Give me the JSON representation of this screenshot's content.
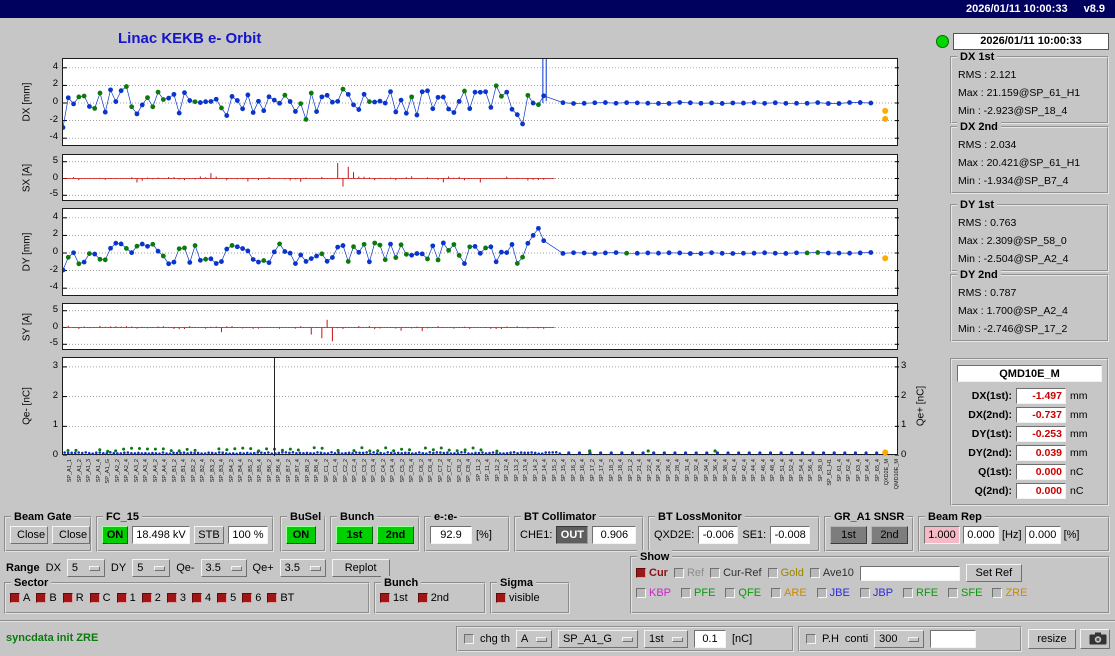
{
  "titlebar": {
    "datetime": "2026/01/11 10:00:33",
    "version": "v8.9"
  },
  "header": {
    "title": "Linac KEKB e- Orbit",
    "timestamp": "2026/01/11 10:00:33"
  },
  "stats_panels": [
    {
      "label": "DX 1st",
      "lines": [
        "RMS : 2.121",
        "Max : 21.159@SP_61_H1",
        "Min : -2.923@SP_18_4"
      ]
    },
    {
      "label": "DX 2nd",
      "lines": [
        "RMS : 2.034",
        "Max : 20.421@SP_61_H1",
        "Min : -1.934@SP_B7_4"
      ]
    },
    {
      "label": "DY 1st",
      "lines": [
        "RMS : 0.763",
        "Max : 2.309@SP_58_0",
        "Min : -2.504@SP_A2_4"
      ]
    },
    {
      "label": "DY 2nd",
      "lines": [
        "RMS : 0.787",
        "Max : 1.700@SP_A2_4",
        "Min : -2.746@SP_17_2"
      ]
    }
  ],
  "qmd": {
    "title": "QMD10E_M",
    "rows": [
      {
        "label": "DX(1st):",
        "value": "-1.497",
        "unit": "mm"
      },
      {
        "label": "DX(2nd):",
        "value": "-0.737",
        "unit": "mm"
      },
      {
        "label": "DY(1st):",
        "value": "-0.253",
        "unit": "mm"
      },
      {
        "label": "DY(2nd):",
        "value": "0.039",
        "unit": "mm"
      },
      {
        "label": "Q(1st):",
        "value": "0.000",
        "unit": "nC"
      },
      {
        "label": "Q(2nd):",
        "value": "0.000",
        "unit": "nC"
      }
    ]
  },
  "plots": {
    "dx": {
      "ylabel": "DX [mm]",
      "ticks": [
        "4",
        "2",
        "0",
        "-2",
        "-4"
      ],
      "ymin": -5,
      "ymax": 5
    },
    "sx": {
      "ylabel": "SX [A]",
      "ticks": [
        "5",
        "0",
        "-5"
      ],
      "ymin": -7,
      "ymax": 7
    },
    "dy": {
      "ylabel": "DY [mm]",
      "ticks": [
        "4",
        "2",
        "0",
        "-2",
        "-4"
      ],
      "ymin": -5,
      "ymax": 5
    },
    "sy": {
      "ylabel": "SY [A]",
      "ticks": [
        "5",
        "0",
        "-5"
      ],
      "ymin": -7,
      "ymax": 7
    },
    "q": {
      "ylabel": "Qe- [nC]",
      "ylabel_right": "Qe+ [nC]",
      "ticks": [
        "3",
        "2",
        "1",
        "0"
      ],
      "ticks_right": [
        "3",
        "2",
        "1",
        "0"
      ],
      "ymin": 0,
      "ymax": 3.3
    }
  },
  "xlabels": [
    "SP_A1_1",
    "SP_A1_2",
    "SP_A1_3",
    "SP_A1_4",
    "SP_A1_G",
    "SP_A2_2",
    "SP_A2_4",
    "SP_A3_2",
    "SP_A3_4",
    "SP_A4_2",
    "SP_A4_4",
    "SP_B1_2",
    "SP_B1_4",
    "SP_B2_2",
    "SP_B2_4",
    "SP_B3_2",
    "SP_B3_4",
    "SP_B4_2",
    "SP_B4_4",
    "SP_B5_2",
    "SP_B5_4",
    "SP_B6_2",
    "SP_B6_4",
    "SP_B7_2",
    "SP_B7_4",
    "SP_B8_2",
    "SP_B8_4",
    "SP_C1_2",
    "SP_C1_4",
    "SP_C2_2",
    "SP_C2_4",
    "SP_C3_2",
    "SP_C3_4",
    "SP_C4_2",
    "SP_C4_4",
    "SP_C5_2",
    "SP_C5_4",
    "SP_C6_2",
    "SP_C6_4",
    "SP_C7_2",
    "SP_C7_4",
    "SP_C8_2",
    "SP_C8_4",
    "SP_11_2",
    "SP_11_4",
    "SP_12_2",
    "SP_12_4",
    "SP_13_2",
    "SP_13_4",
    "SP_14_2",
    "SP_14_4",
    "SP_15_2",
    "SP_15_4",
    "SP_16_2",
    "SP_16_4",
    "SP_17_2",
    "SP_17_4",
    "SP_18_2",
    "SP_18_4",
    "SP_21_2",
    "SP_21_4",
    "SP_22_4",
    "SP_24_4",
    "SP_26_4",
    "SP_28_4",
    "SP_31_4",
    "SP_32_4",
    "SP_34_4",
    "SP_36_4",
    "SP_38_4",
    "SP_41_4",
    "SP_42_4",
    "SP_44_4",
    "SP_46_4",
    "SP_48_4",
    "SP_51_4",
    "SP_52_4",
    "SP_54_4",
    "SP_56_4",
    "SP_58_0",
    "SP_61_H1",
    "SP_61_4",
    "SP_62_4",
    "SP_63_4",
    "SP_64_4",
    "SP_65_4",
    "QXD2E_M",
    "QMD10E_M"
  ],
  "controls": {
    "beam_gate": {
      "label": "Beam Gate",
      "close1": "Close",
      "close2": "Close"
    },
    "fc15": {
      "label": "FC_15",
      "on": "ON",
      "kv": "18.498 kV",
      "stb": "STB",
      "pct": "100 %"
    },
    "busel": {
      "label": "BuSel",
      "on": "ON"
    },
    "bunch": {
      "label": "Bunch",
      "first": "1st",
      "second": "2nd"
    },
    "ee": {
      "label": "e-:e-",
      "value": "92.9",
      "unit": "[%]"
    },
    "bt_collimator": {
      "label": "BT Collimator",
      "che1": "CHE1:",
      "state": "OUT",
      "value": "0.906"
    },
    "bt_lossmonitor": {
      "label": "BT LossMonitor",
      "qxd2e_label": "QXD2E:",
      "qxd2e": "-0.006",
      "se1_label": "SE1:",
      "se1": "-0.008"
    },
    "gr_a1": {
      "label": "GR_A1 SNSR",
      "first": "1st",
      "second": "2nd"
    },
    "beam_rep": {
      "label": "Beam Rep",
      "v1": "1.000",
      "v2": "0.000",
      "hz": "[Hz]",
      "v3": "0.000",
      "pct": "[%]"
    },
    "range": {
      "label": "Range",
      "dx_label": "DX",
      "dx": "5",
      "dy_label": "DY",
      "dy": "5",
      "qem_label": "Qe-",
      "qem": "3.5",
      "qep_label": "Qe+",
      "qep": "3.5",
      "replot": "Replot"
    },
    "sector": {
      "label": "Sector",
      "items": [
        "A",
        "B",
        "R",
        "C",
        "1",
        "2",
        "3",
        "4",
        "5",
        "6",
        "BT"
      ]
    },
    "bunch_sel": {
      "label": "Bunch",
      "items": [
        "1st",
        "2nd"
      ]
    },
    "sigma": {
      "label": "Sigma",
      "items": [
        "visible"
      ]
    },
    "show": {
      "label": "Show",
      "row1": [
        {
          "label": "Cur",
          "color": "#8b1010",
          "checked": true
        },
        {
          "label": "Ref",
          "color": "#8d8d8d",
          "checked": false
        },
        {
          "label": "Cur-Ref",
          "color": "#303030",
          "checked": false
        },
        {
          "label": "Gold",
          "color": "#9a8400",
          "checked": false
        },
        {
          "label": "Ave10",
          "color": "#303030",
          "checked": false
        }
      ],
      "ref_input_value": "",
      "set_ref": "Set Ref",
      "row2": [
        {
          "label": "KBP",
          "color": "#cc22cc",
          "checked": false
        },
        {
          "label": "PFE",
          "color": "#0a9a0a",
          "checked": false
        },
        {
          "label": "QFE",
          "color": "#0a9a0a",
          "checked": false
        },
        {
          "label": "ARE",
          "color": "#cc8a00",
          "checked": false
        },
        {
          "label": "JBE",
          "color": "#2a2ae0",
          "checked": false
        },
        {
          "label": "JBP",
          "color": "#2a2ae0",
          "checked": false
        },
        {
          "label": "RFE",
          "color": "#0a9a0a",
          "checked": false
        },
        {
          "label": "SFE",
          "color": "#0a9a0a",
          "checked": false
        },
        {
          "label": "ZRE",
          "color": "#cc8a00",
          "checked": false
        }
      ]
    },
    "statusbar": {
      "message": "syncdata init ZRE",
      "chg_th": "chg th",
      "dd_a": "A",
      "dd_sp": "SP_A1_G",
      "dd_bunch": "1st",
      "threshold": "0.1",
      "threshold_unit": "[nC]",
      "ph": "P.H",
      "conti": "conti",
      "dd_rate": "300",
      "blank": "",
      "resize": "resize"
    }
  },
  "colors": {
    "on_green": "#00cf00",
    "alarm_pink": "#f4bac6",
    "value_red": "#cc0000",
    "point_blue": "#0a35cc",
    "point_green": "#0a7a0a",
    "stem_red": "#cc1111",
    "mark_orange": "#ffaa00",
    "title_blue": "#1515cc",
    "led_green": "#00d800"
  }
}
